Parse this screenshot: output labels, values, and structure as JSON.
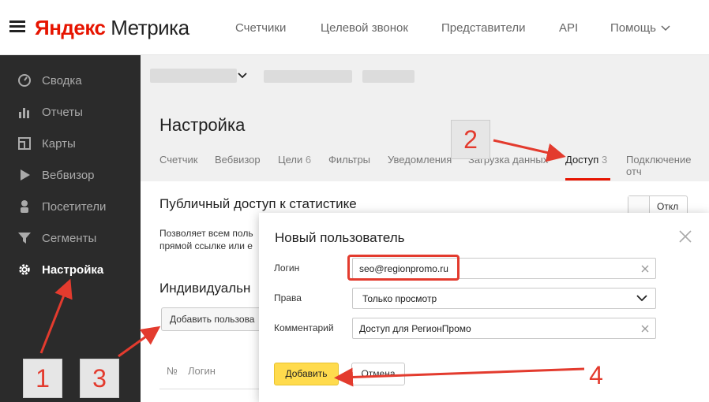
{
  "header": {
    "logo_yandex": "Яндекс",
    "logo_metrika": "Метрика",
    "nav": [
      "Счетчики",
      "Целевой звонок",
      "Представители",
      "API",
      "Помощь"
    ]
  },
  "sidebar": {
    "items": [
      {
        "label": "Сводка",
        "icon": "gauge-icon"
      },
      {
        "label": "Отчеты",
        "icon": "bar-chart-icon"
      },
      {
        "label": "Карты",
        "icon": "map-icon"
      },
      {
        "label": "Вебвизор",
        "icon": "play-icon"
      },
      {
        "label": "Посетители",
        "icon": "user-icon"
      },
      {
        "label": "Сегменты",
        "icon": "filter-icon"
      },
      {
        "label": "Настройка",
        "icon": "gear-icon",
        "active": true
      }
    ]
  },
  "page": {
    "title": "Настройка",
    "tabs": [
      {
        "label": "Счетчик",
        "count": ""
      },
      {
        "label": "Вебвизор",
        "count": ""
      },
      {
        "label": "Цели",
        "count": "6"
      },
      {
        "label": "Фильтры",
        "count": ""
      },
      {
        "label": "Уведомления",
        "count": ""
      },
      {
        "label": "Загрузка данных",
        "count": ""
      },
      {
        "label": "Доступ",
        "count": "3",
        "active": true
      },
      {
        "label": "Подключение отч",
        "count": ""
      }
    ],
    "public_access_title": "Публичный доступ к статистике",
    "public_access_text_1": "Позволяет всем поль",
    "public_access_text_2": "прямой ссылке или е",
    "toggle_label": "Откл",
    "individual_title": "Индивидуальн",
    "add_user_button": "Добавить пользова",
    "table_headers": [
      "№",
      "Логин"
    ]
  },
  "modal": {
    "title": "Новый пользователь",
    "login_label": "Логин",
    "login_value": "seo@regionpromo.ru",
    "rights_label": "Права",
    "rights_value": "Только просмотр",
    "comment_label": "Комментарий",
    "comment_value": "Доступ для РегионПромо",
    "add_button": "Добавить",
    "cancel_button": "Отмена"
  },
  "annotations": [
    "1",
    "2",
    "3",
    "4"
  ],
  "colors": {
    "accent_red": "#e61400",
    "annotation_red": "#e33b2e",
    "yellow_button": "#ffdb4d",
    "sidebar_bg": "#2b2b2b"
  }
}
